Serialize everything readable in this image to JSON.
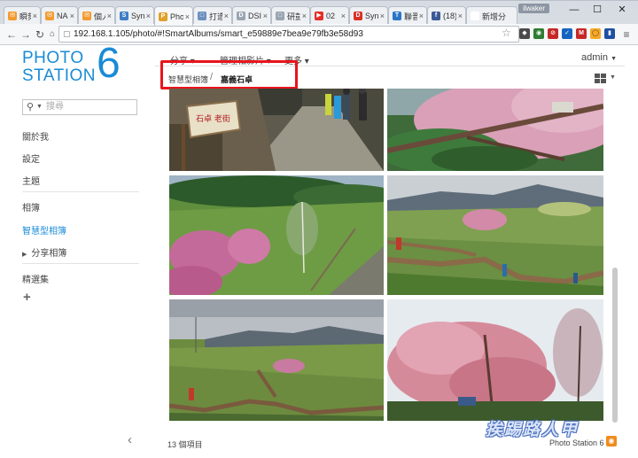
{
  "browser": {
    "tabs": [
      {
        "title": "瞬刻",
        "fav_color": "#f29b30",
        "fav_glyph": "✉"
      },
      {
        "title": "NAS",
        "fav_color": "#f29b30",
        "fav_glyph": "✉"
      },
      {
        "title": "個人",
        "fav_color": "#f29b30",
        "fav_glyph": "✉"
      },
      {
        "title": "Syn",
        "fav_color": "#3f7ec4",
        "fav_glyph": "S"
      },
      {
        "title": "Pho",
        "fav_color": "#e0a02a",
        "fav_glyph": "P"
      },
      {
        "title": "打造",
        "fav_color": "#6b8fbf",
        "fav_glyph": "□"
      },
      {
        "title": "DSI",
        "fav_color": "#9aa5b1",
        "fav_glyph": "D"
      },
      {
        "title": "研彭",
        "fav_color": "#9aa5b1",
        "fav_glyph": "□"
      },
      {
        "title": "02",
        "fav_color": "#e52d27",
        "fav_glyph": "▶"
      },
      {
        "title": "Syn",
        "fav_color": "#d93025",
        "fav_glyph": "D"
      },
      {
        "title": "聯晋",
        "fav_color": "#2a76c6",
        "fav_glyph": "T"
      },
      {
        "title": "(18)",
        "fav_color": "#3b5998",
        "fav_glyph": "f"
      },
      {
        "title": "新增分",
        "fav_color": "#ffffff",
        "fav_glyph": ""
      }
    ],
    "user_badge": "ilwaker",
    "url": "192.168.1.105/photo/#!SmartAlbums/smart_e59889e7bea9e79fb3e58d93"
  },
  "sidebar": {
    "logo_line1": "PHOTO",
    "logo_line2": "STATION",
    "logo_number": "6",
    "search_placeholder": "搜尋",
    "items": [
      {
        "label": "關於我"
      },
      {
        "label": "設定"
      },
      {
        "label": "主題"
      },
      {
        "label": "相簿"
      },
      {
        "label": "智慧型相簿"
      },
      {
        "label": "分享相簿"
      },
      {
        "label": "精選集"
      }
    ]
  },
  "topnav": {
    "share": "分享",
    "manage": "管理相影片",
    "more": "更多",
    "user": "admin"
  },
  "breadcrumb": {
    "parent": "智慧型相簿",
    "separator": "/",
    "current": "嘉義石卓"
  },
  "photos": [
    {
      "name": "photo-1"
    },
    {
      "name": "photo-2"
    },
    {
      "name": "photo-3"
    },
    {
      "name": "photo-4"
    },
    {
      "name": "photo-5"
    },
    {
      "name": "photo-6"
    }
  ],
  "footer": {
    "count": "13 個項目",
    "brand": "Photo Station 6"
  },
  "watermark": "挨踢路人甲",
  "colors": {
    "accent": "#1a8bd6",
    "highlight": "#e8141b"
  }
}
